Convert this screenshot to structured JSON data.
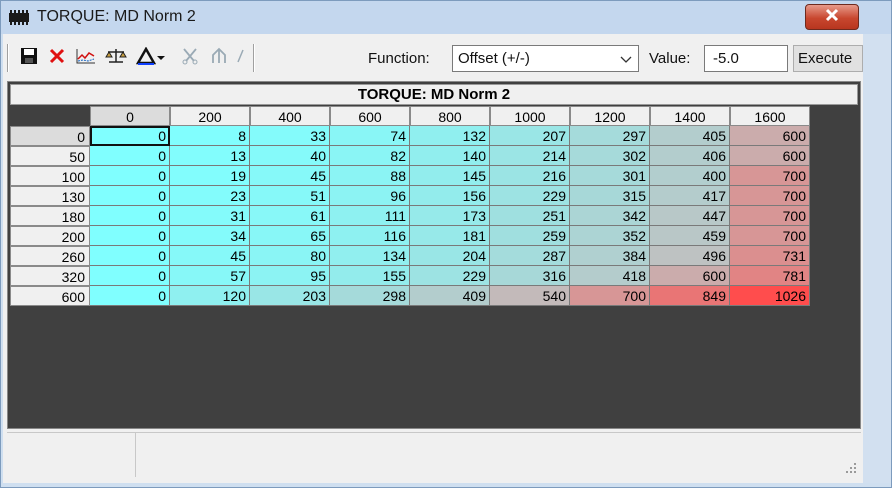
{
  "window": {
    "title": "TORQUE: MD Norm 2"
  },
  "toolbar": {
    "function_label": "Function:",
    "function_value": "Offset (+/-)",
    "value_label": "Value:",
    "value": "-5.0",
    "execute_label": "Execute"
  },
  "table": {
    "title": "TORQUE: MD Norm 2",
    "columns": [
      "0",
      "200",
      "400",
      "600",
      "800",
      "1000",
      "1200",
      "1400",
      "1600"
    ],
    "rows": [
      {
        "label": "0",
        "values": [
          "0",
          "8",
          "33",
          "74",
          "132",
          "207",
          "297",
          "405",
          "600"
        ]
      },
      {
        "label": "50",
        "values": [
          "0",
          "13",
          "40",
          "82",
          "140",
          "214",
          "302",
          "406",
          "600"
        ]
      },
      {
        "label": "100",
        "values": [
          "0",
          "19",
          "45",
          "88",
          "145",
          "216",
          "301",
          "400",
          "700"
        ]
      },
      {
        "label": "130",
        "values": [
          "0",
          "23",
          "51",
          "96",
          "156",
          "229",
          "315",
          "417",
          "700"
        ]
      },
      {
        "label": "180",
        "values": [
          "0",
          "31",
          "61",
          "111",
          "173",
          "251",
          "342",
          "447",
          "700"
        ]
      },
      {
        "label": "200",
        "values": [
          "0",
          "34",
          "65",
          "116",
          "181",
          "259",
          "352",
          "459",
          "700"
        ]
      },
      {
        "label": "260",
        "values": [
          "0",
          "45",
          "80",
          "134",
          "204",
          "287",
          "384",
          "496",
          "731"
        ]
      },
      {
        "label": "320",
        "values": [
          "0",
          "57",
          "95",
          "155",
          "229",
          "316",
          "418",
          "600",
          "781"
        ]
      },
      {
        "label": "600",
        "values": [
          "0",
          "120",
          "203",
          "298",
          "409",
          "540",
          "700",
          "849",
          "1026"
        ]
      }
    ]
  },
  "colors": {
    "low": "#80ffff",
    "high": "#ff4d4d",
    "titlebar": "#c4d7ee",
    "close": "#c8472f"
  },
  "icons": [
    "chip-icon",
    "save-icon",
    "delete-x-icon",
    "graph-icon",
    "balance-scale-icon",
    "delta-icon",
    "dropdown-arrow-icon",
    "scissors-icon",
    "split-arrow-icon",
    "slash-icon",
    "close-icon",
    "resize-grip-icon"
  ]
}
